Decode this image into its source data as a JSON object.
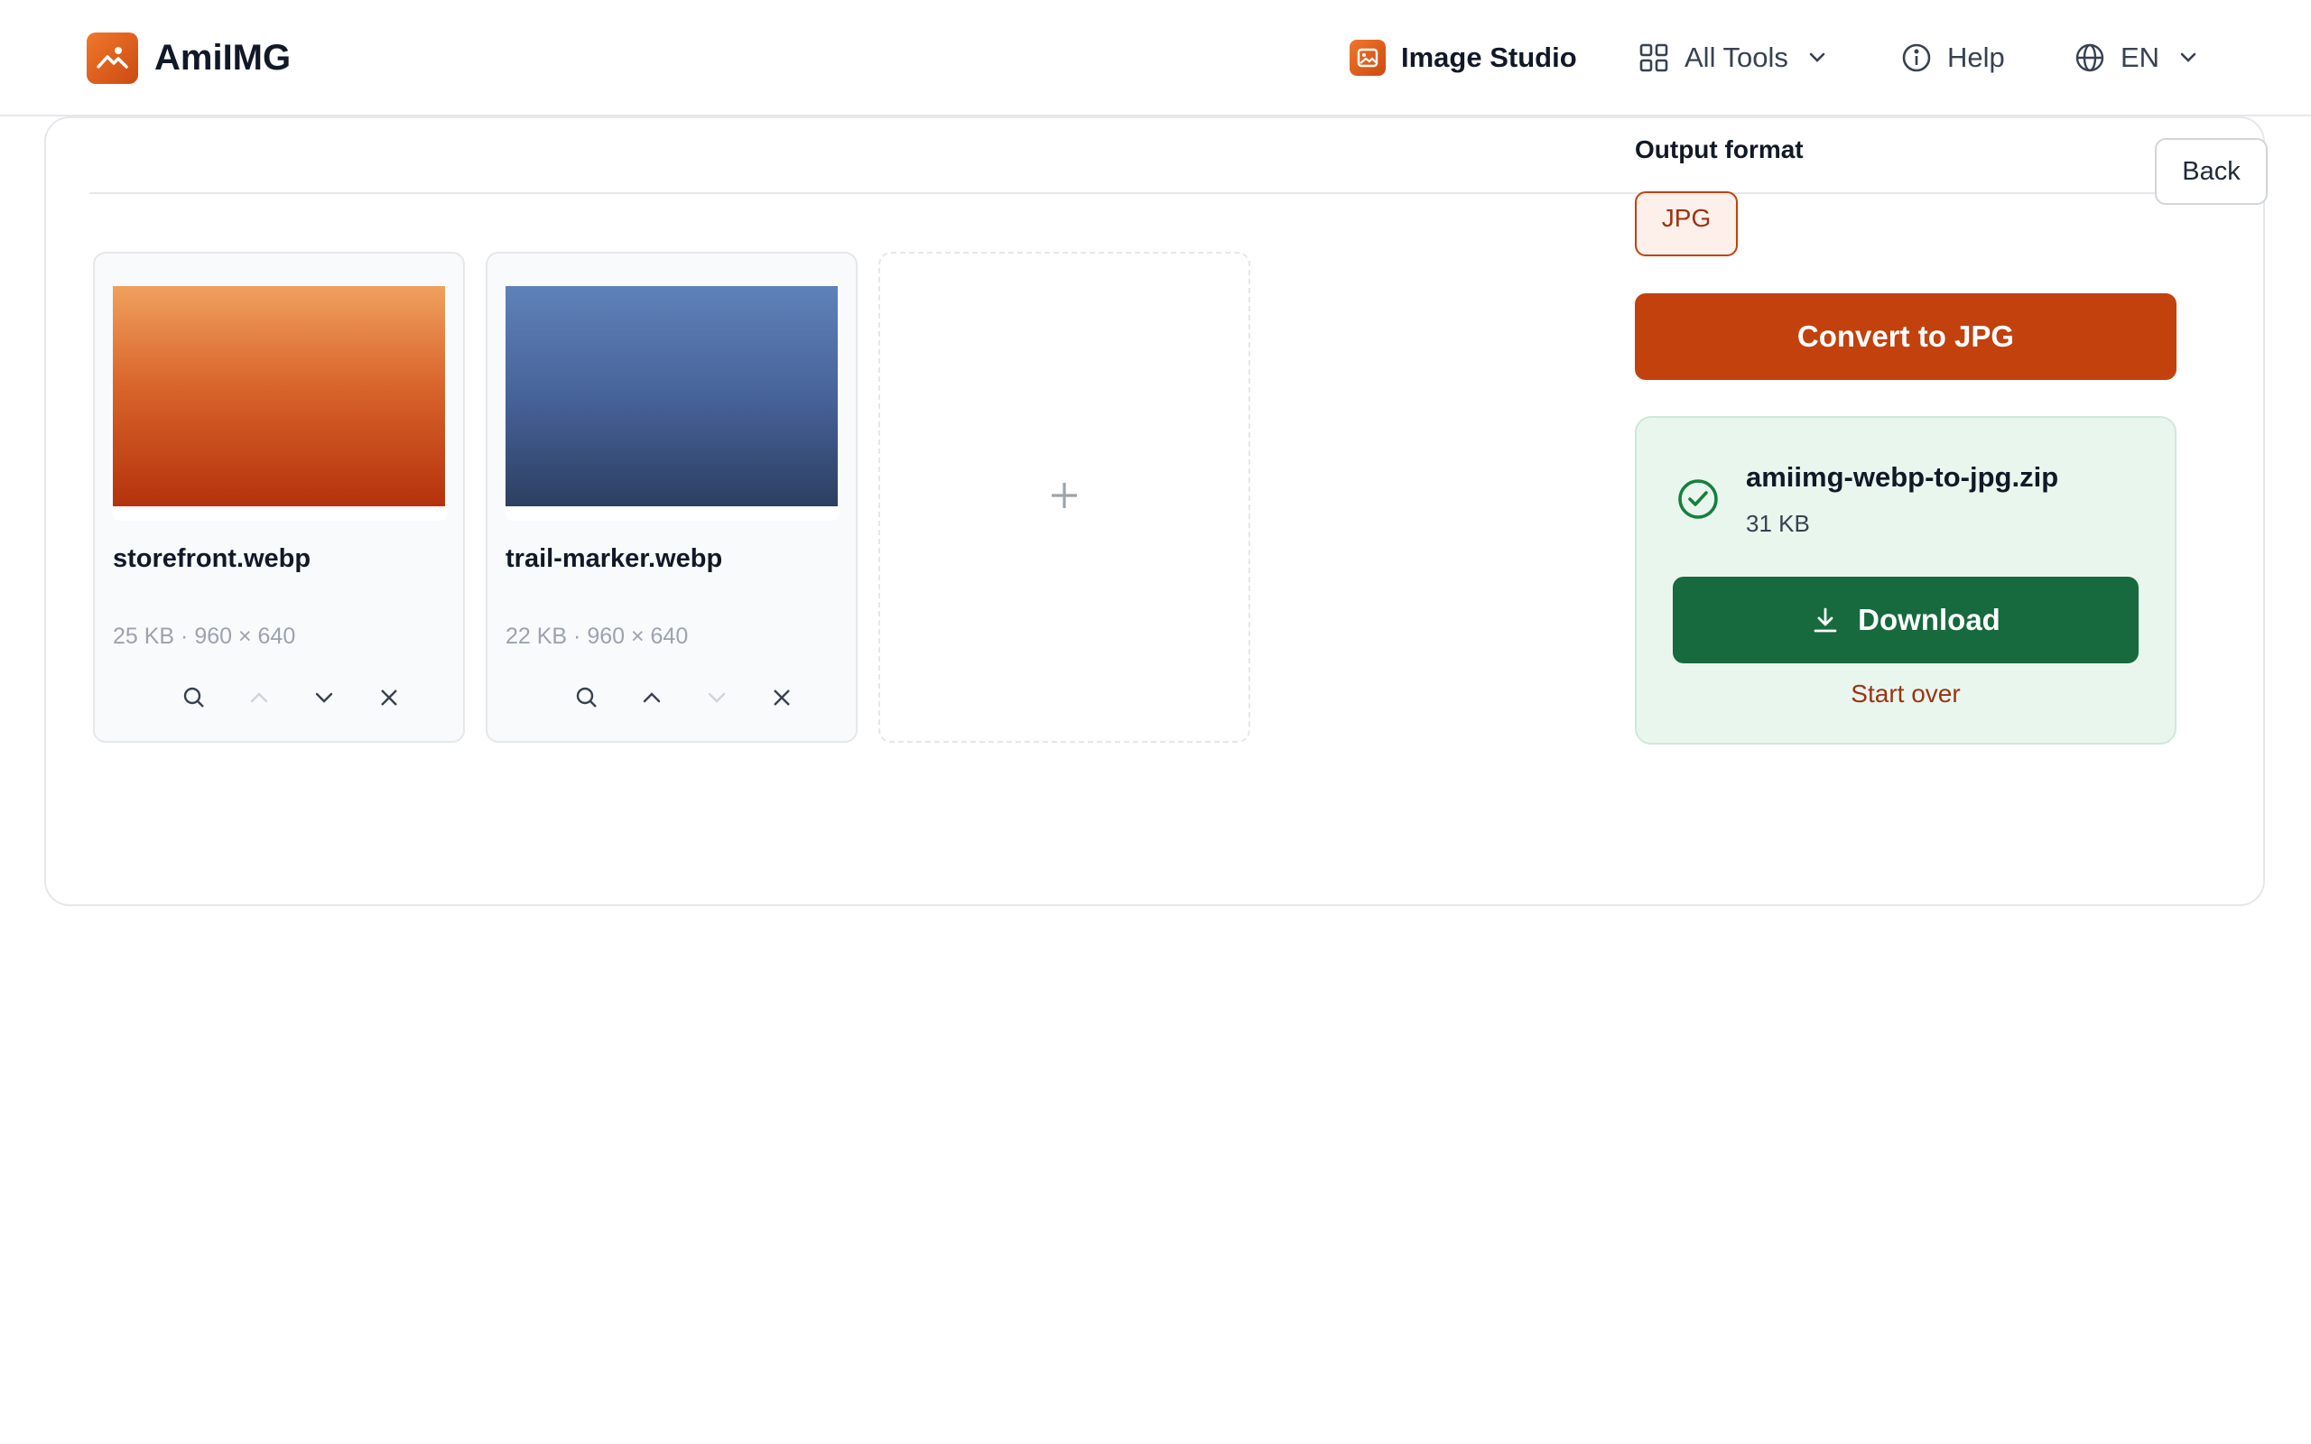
{
  "app": {
    "brand": "AmiIMG"
  },
  "nav": {
    "studio_label": "Image Studio",
    "tools_label": "All Tools",
    "help_label": "Help",
    "lang_label": "EN"
  },
  "toolbar": {
    "back_label": "Back"
  },
  "files": [
    {
      "name": "storefront.webp",
      "meta": "25 KB · 960 × 640",
      "thumb": "orange"
    },
    {
      "name": "trail-marker.webp",
      "meta": "22 KB · 960 × 640",
      "thumb": "blue"
    }
  ],
  "add_slot": {
    "symbol": "+"
  },
  "output": {
    "label": "Output format",
    "format": "JPG",
    "convert_label": "Convert to JPG"
  },
  "result": {
    "file_name": "amiimg-webp-to-jpg.zip",
    "file_size": "31 KB",
    "download_label": "Download",
    "start_over_label": "Start over"
  },
  "colors": {
    "accent": "#c2410c",
    "success": "#166a3e",
    "success_bg": "#e9f6ee"
  }
}
